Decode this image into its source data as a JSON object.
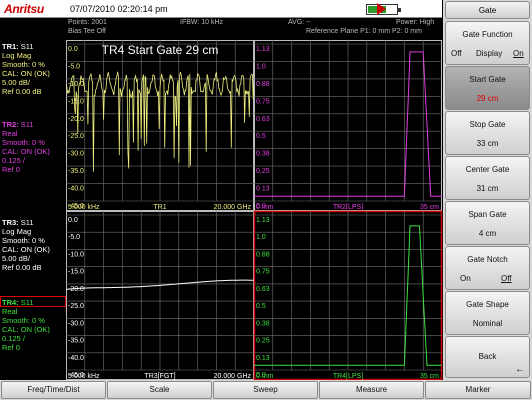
{
  "header": {
    "logo": "Anritsu",
    "datetime": "07/07/2010 02:20:14 pm"
  },
  "status": {
    "points": "Points: 2001",
    "ifbw": "IFBW: 10 kHz",
    "avg": "AVG: --",
    "power": "Power: High",
    "bias": "Bias Tee Off",
    "ref_plane": "Reference Plane P1: 0 mm P2: 0 mm"
  },
  "traces": {
    "tr1": {
      "name": "TR1:",
      "param": "S11",
      "lines": [
        "Log Mag",
        "Smooth: 0 %",
        "CAL: ON (OK)",
        "5.00 dB/",
        "Ref 0.00 dB"
      ]
    },
    "tr2": {
      "name": "TR2:",
      "param": "S11",
      "lines": [
        "Real",
        "Smooth: 0 %",
        "CAL: ON (OK)",
        "0.125 /",
        "Ref 0"
      ]
    },
    "tr3": {
      "name": "TR3:",
      "param": "S11",
      "lines": [
        "Log Mag",
        "Smooth: 0 %",
        "CAL: ON (OK)",
        "5.00 dB/",
        "Ref 0.00 dB"
      ]
    },
    "tr4": {
      "name": "TR4:",
      "param": "S11",
      "lines": [
        "Real",
        "Smooth: 0 %",
        "CAL: ON (OK)",
        "0.125 /",
        "Ref 0"
      ]
    }
  },
  "plots": {
    "tr1": {
      "banner": "TR4 Start Gate 29 cm",
      "x_start": "5.000 kHz",
      "x_mid": "TR1",
      "x_end": "20.000 GHz",
      "y_labels": [
        "0.0",
        "-5.0",
        "-10.0",
        "-15.0",
        "-20.0",
        "-25.0",
        "-30.0",
        "-35.0",
        "-40.0",
        "-45.0"
      ]
    },
    "tr2": {
      "x_start": "0 mm",
      "x_mid": "TR2[LPS]",
      "x_end": "35 cm",
      "y_labels": [
        "1.13",
        "1.0",
        "0.88",
        "0.75",
        "0.63",
        "0.5",
        "0.38",
        "0.25",
        "0.13",
        "0.0"
      ]
    },
    "tr3": {
      "x_start": "5.000 kHz",
      "x_mid": "TR3[FGT]",
      "x_end": "20.000 GHz",
      "y_labels": [
        "0.0",
        "-5.0",
        "-10.0",
        "-15.0",
        "-20.0",
        "-25.0",
        "-30.0",
        "-35.0",
        "-40.0",
        "-45.0"
      ]
    },
    "tr4": {
      "x_start": "0 mm",
      "x_mid": "TR4[LPS]",
      "x_end": "35 cm",
      "y_labels": [
        "1.13",
        "1.0",
        "0.88",
        "0.75",
        "0.63",
        "0.5",
        "0.38",
        "0.25",
        "0.13",
        "0.0"
      ]
    }
  },
  "softkeys": {
    "title": "Gate",
    "gate_function": {
      "label": "Gate Function",
      "options": [
        "Off",
        "Display",
        "On"
      ]
    },
    "start_gate": {
      "label": "Start Gate",
      "value": "29 cm"
    },
    "stop_gate": {
      "label": "Stop Gate",
      "value": "33 cm"
    },
    "center_gate": {
      "label": "Center Gate",
      "value": "31 cm"
    },
    "span_gate": {
      "label": "Span Gate",
      "value": "4 cm"
    },
    "gate_notch": {
      "label": "Gate Notch",
      "options": [
        "On",
        "Off"
      ]
    },
    "gate_shape": {
      "label": "Gate Shape",
      "value": "Nominal"
    },
    "back": {
      "label": "Back"
    }
  },
  "bottom_menu": [
    "Freq/Time/Dist",
    "Scale",
    "Sweep",
    "Measure",
    "Marker"
  ],
  "colors": {
    "tr1": "#f0f080",
    "tr2": "#e040e0",
    "tr3": "#ffffff",
    "tr4": "#40e040",
    "active_border": "#d00000",
    "grid": "#707070"
  }
}
